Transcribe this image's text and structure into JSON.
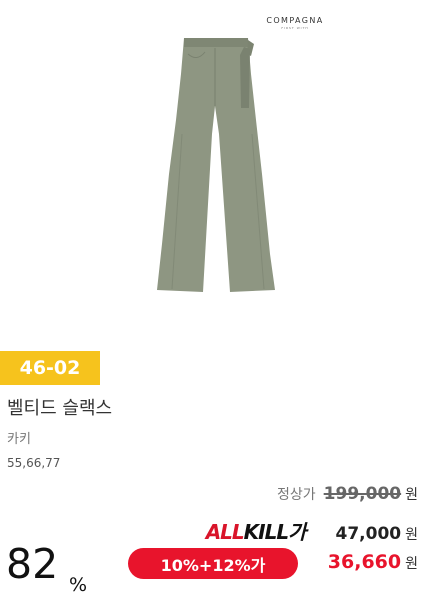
{
  "brand": {
    "name": "COMPAGNA",
    "sub": "FIRST WITH"
  },
  "product": {
    "image_icon": "wide-leg-slacks-image",
    "image_color": "#8e9682",
    "code": "46-02",
    "name": "벨티드 슬랙스",
    "color": "카키",
    "sizes": "55,66,77"
  },
  "pricing": {
    "regular_label": "정상가",
    "regular_price": "199,000",
    "currency": "원",
    "allkill_logo_part1": "ALL",
    "allkill_logo_part2": "KILL",
    "allkill_logo_part3": "가",
    "allkill_price": "47,000",
    "discount_label": "10%+12%가",
    "final_price": "36,660"
  },
  "rate": {
    "value": "82",
    "unit": "%"
  },
  "colors": {
    "badge": "#f6c31d",
    "accent": "#e8142c"
  }
}
